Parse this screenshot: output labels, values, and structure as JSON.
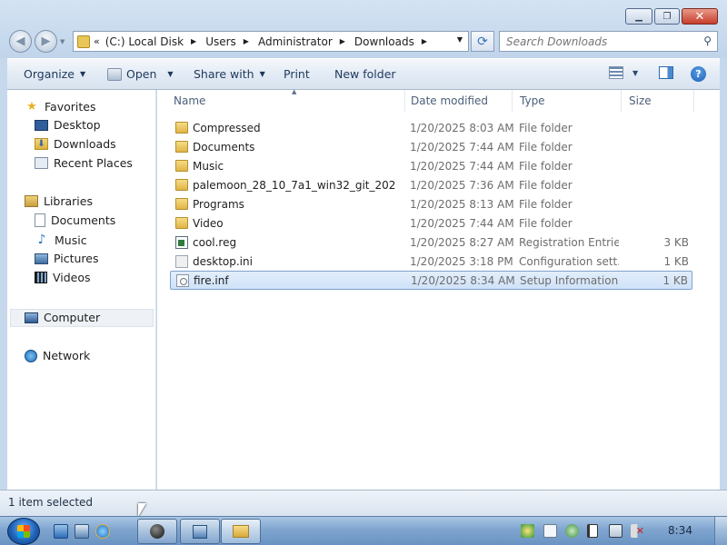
{
  "window": {
    "controls": {
      "minimize": "▁",
      "maximize": "❐",
      "close": "✕"
    }
  },
  "address": {
    "chevrons": "«",
    "crumbs": [
      "(C:) Local Disk",
      "Users",
      "Administrator",
      "Downloads"
    ]
  },
  "search": {
    "placeholder": "Search Downloads"
  },
  "toolbar": {
    "organize": "Organize",
    "open": "Open",
    "share_with": "Share with",
    "print": "Print",
    "new_folder": "New folder",
    "help": "?"
  },
  "nav": {
    "favorites": {
      "label": "Favorites",
      "items": [
        "Desktop",
        "Downloads",
        "Recent Places"
      ]
    },
    "libraries": {
      "label": "Libraries",
      "items": [
        "Documents",
        "Music",
        "Pictures",
        "Videos"
      ]
    },
    "computer": "Computer",
    "network": "Network"
  },
  "columns": {
    "name": "Name",
    "date": "Date modified",
    "type": "Type",
    "size": "Size"
  },
  "files": [
    {
      "name": "Compressed",
      "date": "1/20/2025 8:03 AM",
      "type": "File folder",
      "size": "",
      "icon": "folder-icon"
    },
    {
      "name": "Documents",
      "date": "1/20/2025 7:44 AM",
      "type": "File folder",
      "size": "",
      "icon": "folder-icon"
    },
    {
      "name": "Music",
      "date": "1/20/2025 7:44 AM",
      "type": "File folder",
      "size": "",
      "icon": "folder-icon"
    },
    {
      "name": "palemoon_28_10_7a1_win32_git_202",
      "date": "1/20/2025 7:36 AM",
      "type": "File folder",
      "size": "",
      "icon": "folder-icon"
    },
    {
      "name": "Programs",
      "date": "1/20/2025 8:13 AM",
      "type": "File folder",
      "size": "",
      "icon": "folder-icon"
    },
    {
      "name": "Video",
      "date": "1/20/2025 7:44 AM",
      "type": "File folder",
      "size": "",
      "icon": "folder-icon"
    },
    {
      "name": "cool.reg",
      "date": "1/20/2025 8:27 AM",
      "type": "Registration Entries",
      "size": "3 KB",
      "icon": "registry-file-icon"
    },
    {
      "name": "desktop.ini",
      "date": "1/20/2025 3:18 PM",
      "type": "Configuration sett...",
      "size": "1 KB",
      "icon": "config-file-icon"
    },
    {
      "name": "fire.inf",
      "date": "1/20/2025 8:34 AM",
      "type": "Setup Information",
      "size": "1 KB",
      "icon": "setup-file-icon"
    }
  ],
  "selected_file": "fire.inf",
  "status": {
    "text": "1 item selected"
  },
  "taskbar": {
    "clock": "8:34"
  }
}
